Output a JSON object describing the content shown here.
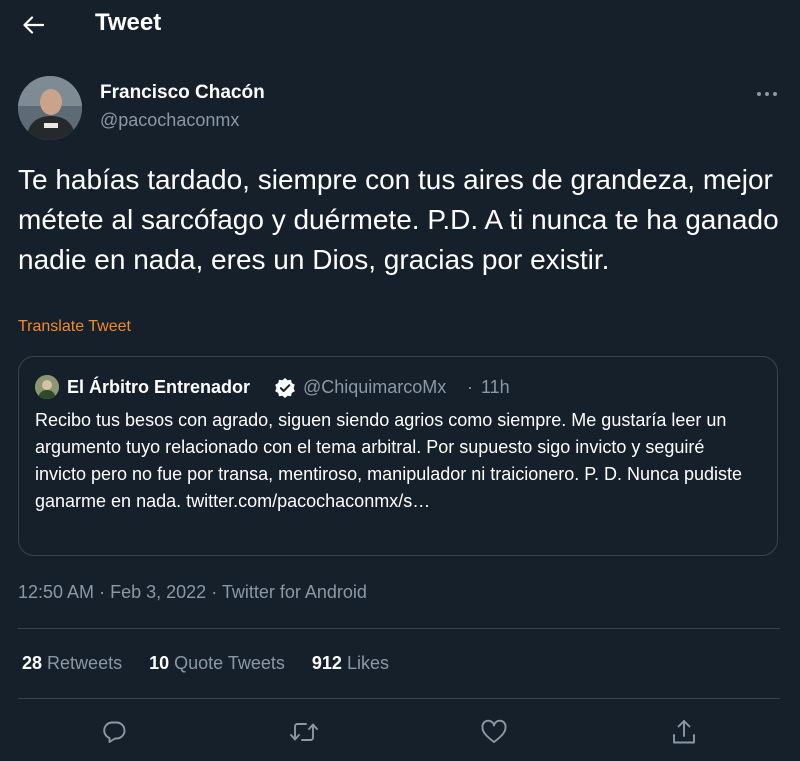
{
  "header": {
    "title": "Tweet"
  },
  "tweet": {
    "author_name": "Francisco Chacón",
    "author_handle": "@pacochaconmx",
    "text": "Te habías tardado, siempre con tus aires de grandeza, mejor métete al sarcófago y duérmete. P.D. A ti nunca te ha ganado nadie en nada, eres un Dios, gracias por existir.",
    "translate_label": "Translate Tweet",
    "time": "12:50 AM",
    "date": "Feb 3, 2022",
    "source": "Twitter for Android",
    "separator": "·"
  },
  "quote": {
    "author_name": "El Árbitro Entrenador",
    "author_handle": "@ChiquimarcoMx",
    "separator": "·",
    "time_ago": "11h",
    "text": "Recibo tus besos con agrado, siguen siendo agrios como siempre. Me gustaría leer un argumento tuyo relacionado con el tema arbitral. Por supuesto sigo invicto y seguiré invicto pero no fue por transa, mentiroso, manipulador ni traicionero. P. D. Nunca pudiste ganarme en nada. twitter.com/pacochaconmx/s…"
  },
  "stats": {
    "retweets_count": "28",
    "retweets_label": "Retweets",
    "quotes_count": "10",
    "quotes_label": "Quote Tweets",
    "likes_count": "912",
    "likes_label": "Likes"
  },
  "icons": {
    "back": "arrow-left-icon",
    "more": "more-horizontal-icon",
    "verified": "verified-badge-icon",
    "reply": "reply-icon",
    "retweet": "retweet-icon",
    "like": "heart-icon",
    "share": "share-icon"
  },
  "colors": {
    "background": "#15202b",
    "text_primary": "#ffffff",
    "text_secondary": "#8b98a5",
    "border": "#38444d",
    "translate_link": "#f18a2d"
  }
}
